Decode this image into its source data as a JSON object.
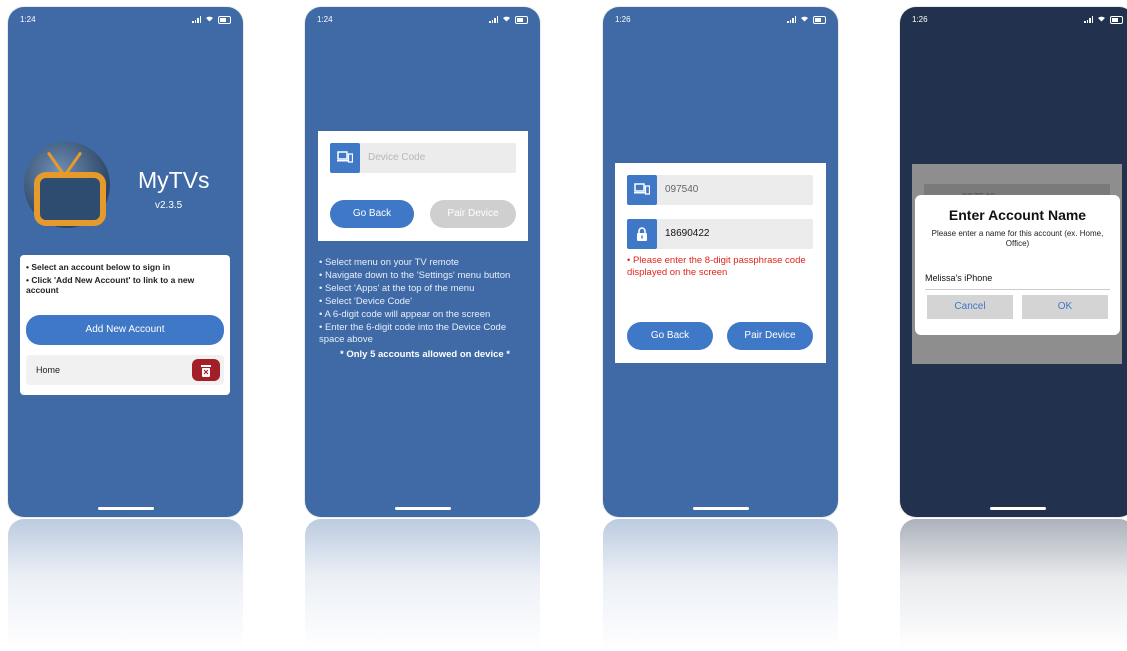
{
  "screens": [
    {
      "time": "1:24",
      "app_name": "MyTVs",
      "version": "v2.3.5",
      "instructions": [
        "• Select an account below to sign in",
        "• Click 'Add New Account' to link to a new account"
      ],
      "add_account_label": "Add New Account",
      "account_name": "Home"
    },
    {
      "time": "1:24",
      "device_code_placeholder": "Device Code",
      "go_back_label": "Go Back",
      "pair_device_label": "Pair Device",
      "steps": [
        "• Select menu on your TV remote",
        "• Navigate down to the 'Settings' menu button",
        "• Select 'Apps' at the top of the menu",
        "• Select 'Device Code'",
        "• A 6-digit code will appear on the screen",
        "• Enter the 6-digit code into the Device Code space above"
      ],
      "limit_note": "* Only 5 accounts allowed on device *"
    },
    {
      "time": "1:26",
      "device_code_value": "097540",
      "passphrase_value": "18690422",
      "error_text": "• Please enter the 8-digit passphrase code displayed on the screen",
      "go_back_label": "Go Back",
      "pair_device_label": "Pair Device"
    },
    {
      "time": "1:26",
      "background_code": "097540",
      "dialog": {
        "title": "Enter Account Name",
        "message": "Please enter a name for this account (ex. Home, Office)",
        "input_value": "Melissa's iPhone",
        "cancel_label": "Cancel",
        "ok_label": "OK"
      }
    }
  ],
  "colors": {
    "phone_bg": "#3f6aa6",
    "phone_bg_dark": "#22314d",
    "accent_blue": "#3f78c6",
    "delete_red": "#a21f27",
    "error_red": "#e0241b",
    "logo_orange": "#e59a2b"
  }
}
